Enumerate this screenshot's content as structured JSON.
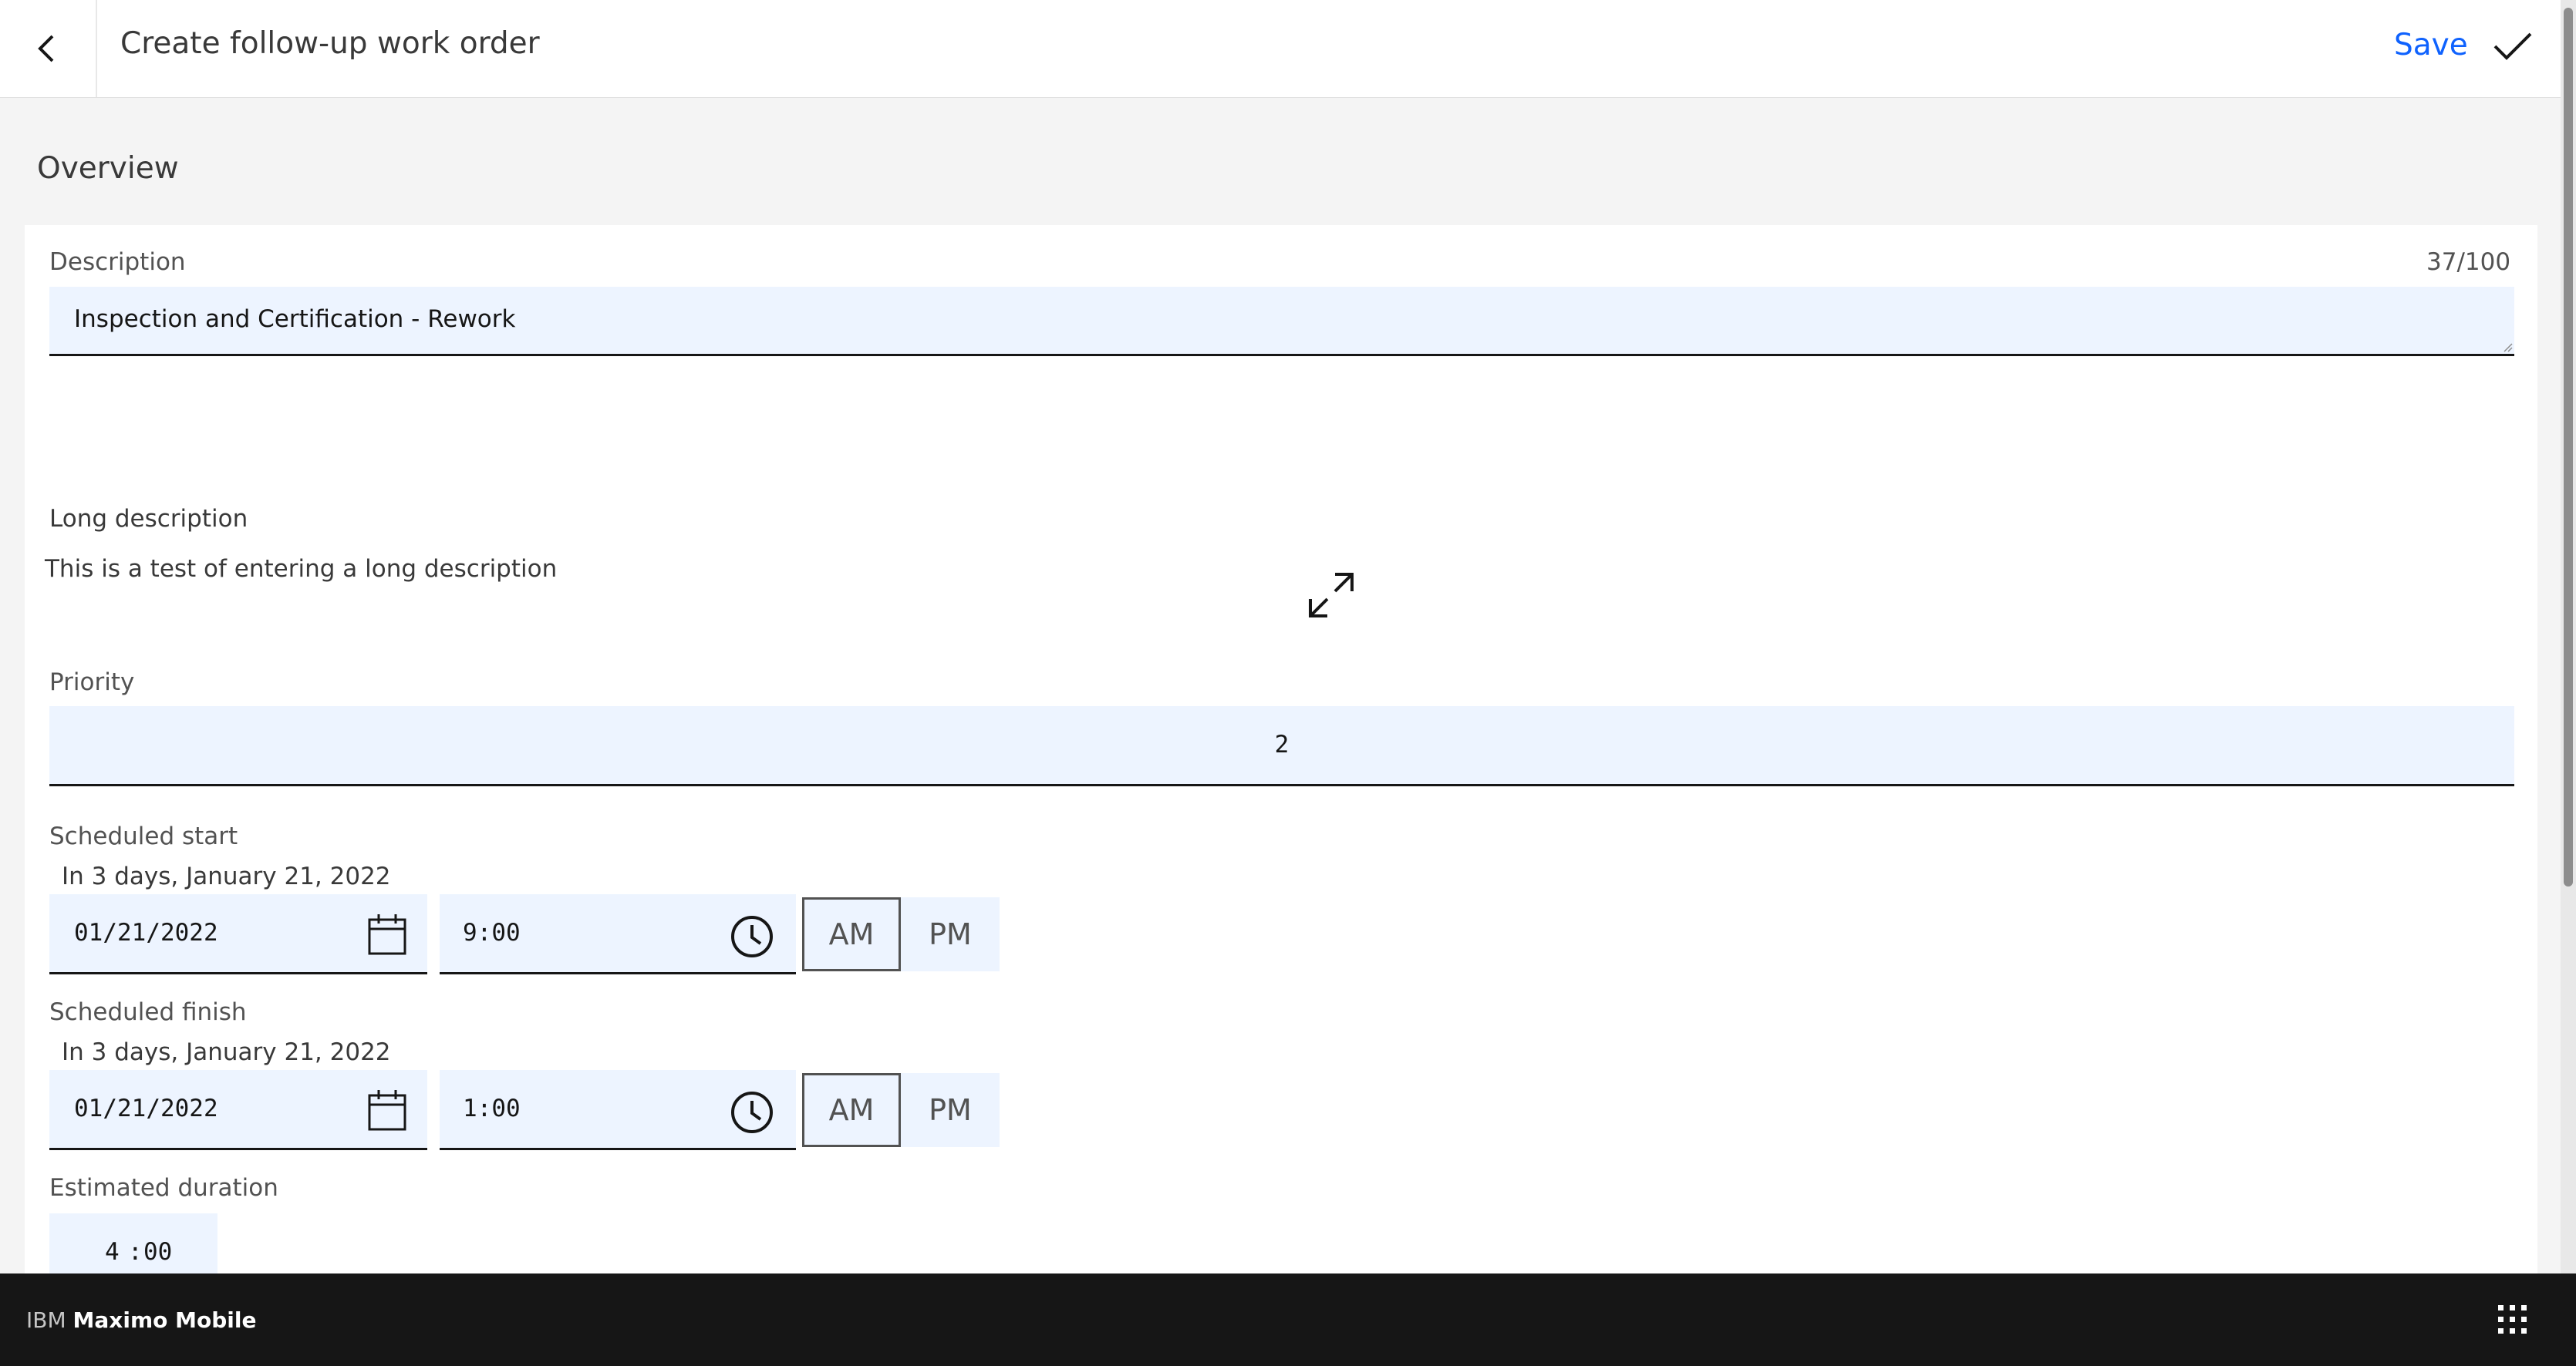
{
  "header": {
    "title": "Create follow-up work order",
    "save_label": "Save"
  },
  "section": {
    "title": "Overview"
  },
  "description": {
    "label": "Description",
    "counter": "37/100",
    "value": "Inspection and Certification - Rework"
  },
  "long_description": {
    "label": "Long description",
    "value": "This is a test of entering a long description"
  },
  "priority": {
    "label": "Priority",
    "value": "2"
  },
  "scheduled_start": {
    "label": "Scheduled start",
    "helper": "In 3 days, January 21, 2022",
    "date": "01/21/2022",
    "time": "9:00",
    "am_label": "AM",
    "pm_label": "PM",
    "selected": "AM"
  },
  "scheduled_finish": {
    "label": "Scheduled finish",
    "helper": "In 3 days, January 21, 2022",
    "date": "01/21/2022",
    "time": "1:00",
    "am_label": "AM",
    "pm_label": "PM",
    "selected": "AM"
  },
  "estimated_duration": {
    "label": "Estimated duration",
    "hours": "4",
    "separator": ":",
    "minutes": "00"
  },
  "footer": {
    "brand_prefix": "IBM",
    "brand_name": "Maximo Mobile"
  },
  "colors": {
    "accent": "#0f62fe",
    "field_bg": "#edf4ff",
    "footer_bg": "#161616",
    "page_bg": "#f4f4f4"
  },
  "icons": [
    "chevron-left-icon",
    "checkmark-icon",
    "maximize-icon",
    "calendar-icon",
    "clock-icon",
    "app-switcher-icon"
  ]
}
